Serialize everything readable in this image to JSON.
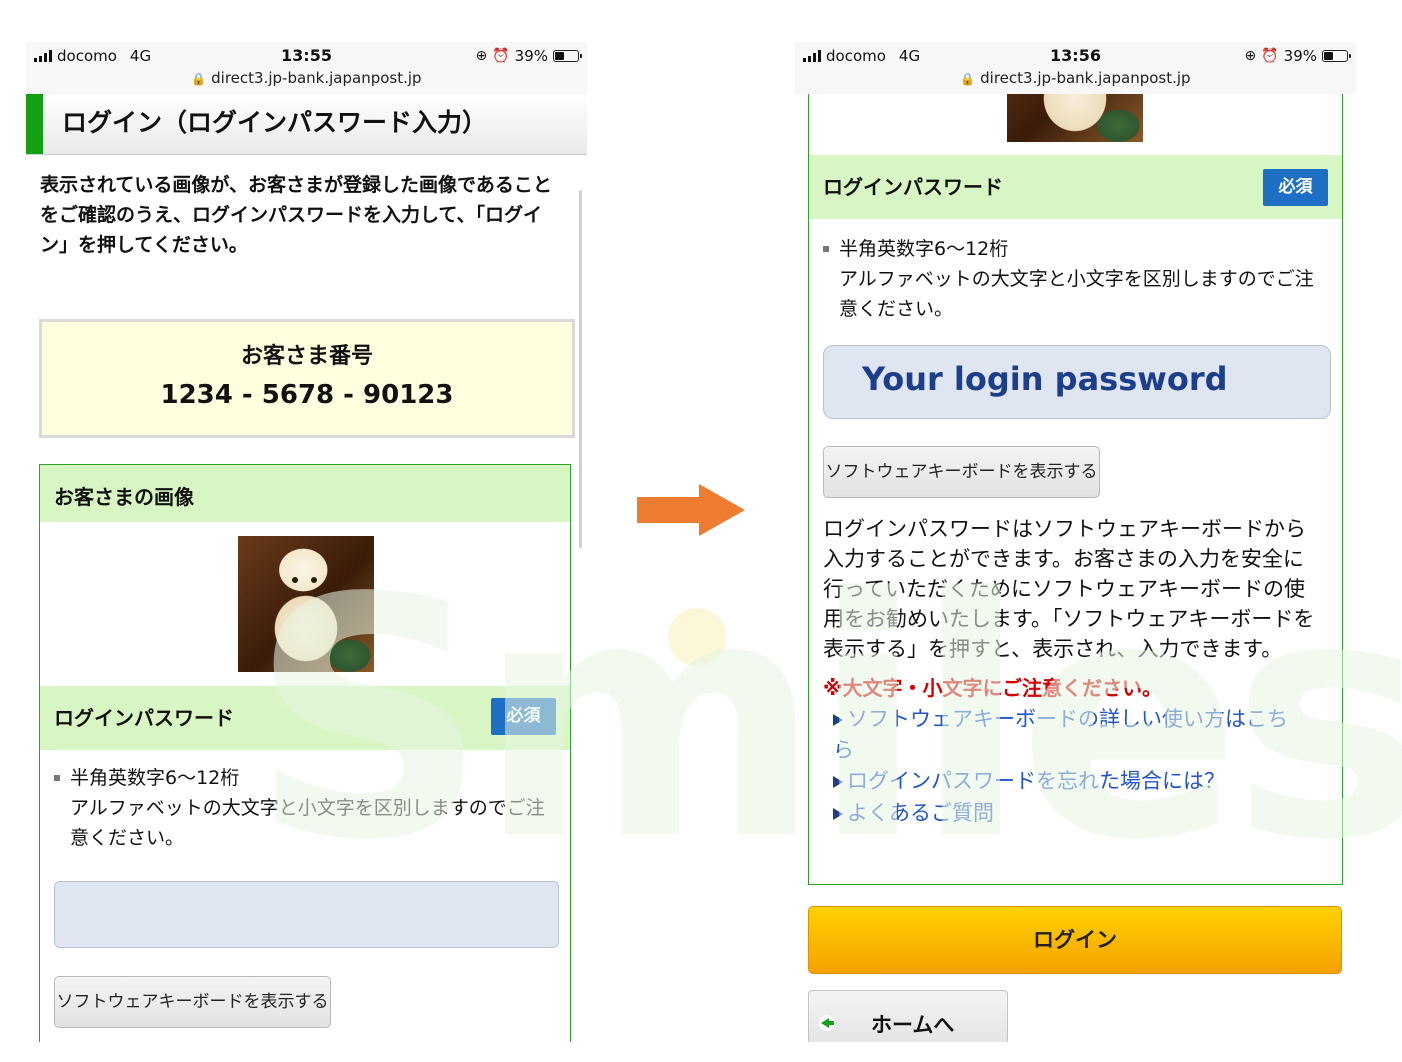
{
  "status_bar_left": {
    "carrier": "docomo",
    "network": "4G",
    "time": "13:55",
    "battery": "39%",
    "url": "direct3.jp-bank.japanpost.jp"
  },
  "status_bar_right": {
    "carrier": "docomo",
    "network": "4G",
    "time": "13:56",
    "battery": "39%",
    "url": "direct3.jp-bank.japanpost.jp"
  },
  "left_screen": {
    "page_title": "ログイン（ログインパスワード入力）",
    "instructions": "表示されている画像が、お客さまが登録した画像であることをご確認のうえ、ログインパスワードを入力して、「ログイン」を押してください。",
    "customer_number_label": "お客さま番号",
    "customer_number": "1234 - 5678 - 90123",
    "image_section_title": "お客さまの画像",
    "password_section_title": "ログインパスワード",
    "required_badge": "必須",
    "rule_line1": "半角英数字6～12桁",
    "rule_line2": "アルファベットの大文字と小文字を区別しますのでご注意ください。",
    "password_value": "",
    "soft_keyboard_button": "ソフトウェアキーボードを表示する"
  },
  "right_screen": {
    "password_section_title": "ログインパスワード",
    "required_badge": "必須",
    "rule_line1": "半角英数字6～12桁",
    "rule_line2": "アルファベットの大文字と小文字を区別しますのでご注意ください。",
    "password_value": "Your login password",
    "soft_keyboard_button": "ソフトウェアキーボードを表示する",
    "soft_keyboard_description": "ログインパスワードはソフトウェアキーボードから入力することができます。お客さまの入力を安全に行っていただくためにソフトウェアキーボードの使用をお勧めいたします。「ソフトウェアキーボードを表示する」を押すと、表示され、入力できます。",
    "caution": "※大文字・小文字にご注意ください。",
    "links": [
      "ソフトウェアキーボードの詳しい使い方はこちら",
      "ログインパスワードを忘れた場合には？",
      "よくあるご質問"
    ],
    "login_button": "ログイン",
    "home_button": "ホームへ"
  },
  "watermark_text": "Smiles",
  "colors": {
    "green_border": "#2aa52a",
    "section_bg": "#d8f5c4",
    "badge_blue": "#1e70c4",
    "login_orange": "#f4a100",
    "arrow_orange": "#ee7d32",
    "caution_red": "#d40000",
    "link_blue": "#2255cc"
  }
}
